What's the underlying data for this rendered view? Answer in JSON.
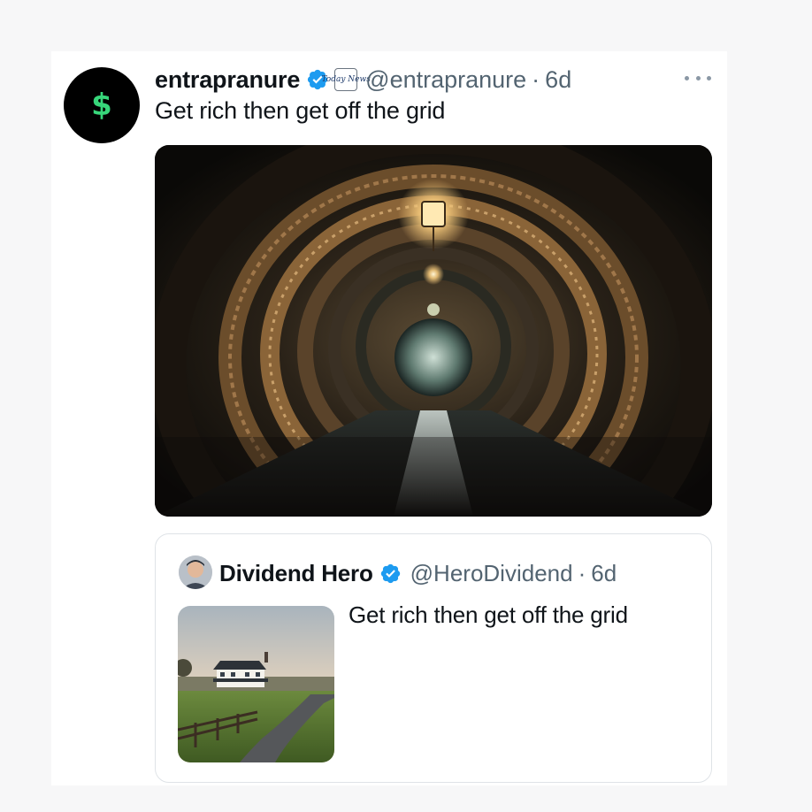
{
  "tweet": {
    "avatar_symbol": "$",
    "display_name": "entrapranure",
    "affiliate_badge_text": "Today News",
    "handle": "@entrapranure",
    "separator": "·",
    "time": "6d",
    "text": "Get rich then get off the grid",
    "more_icon": "more-horizontal-icon",
    "media_description_icon": "tunnel-photo"
  },
  "quote": {
    "display_name": "Dividend Hero",
    "handle": "@HeroDividend",
    "separator": "·",
    "time": "6d",
    "text": "Get rich then get off the grid",
    "thumbnail_icon": "farmhouse-photo"
  },
  "colors": {
    "verified": "#1d9bf0",
    "secondary_text": "#536471",
    "avatar_bg": "#000000",
    "avatar_symbol": "#37d67a",
    "quote_border": "#dfe3e7"
  }
}
